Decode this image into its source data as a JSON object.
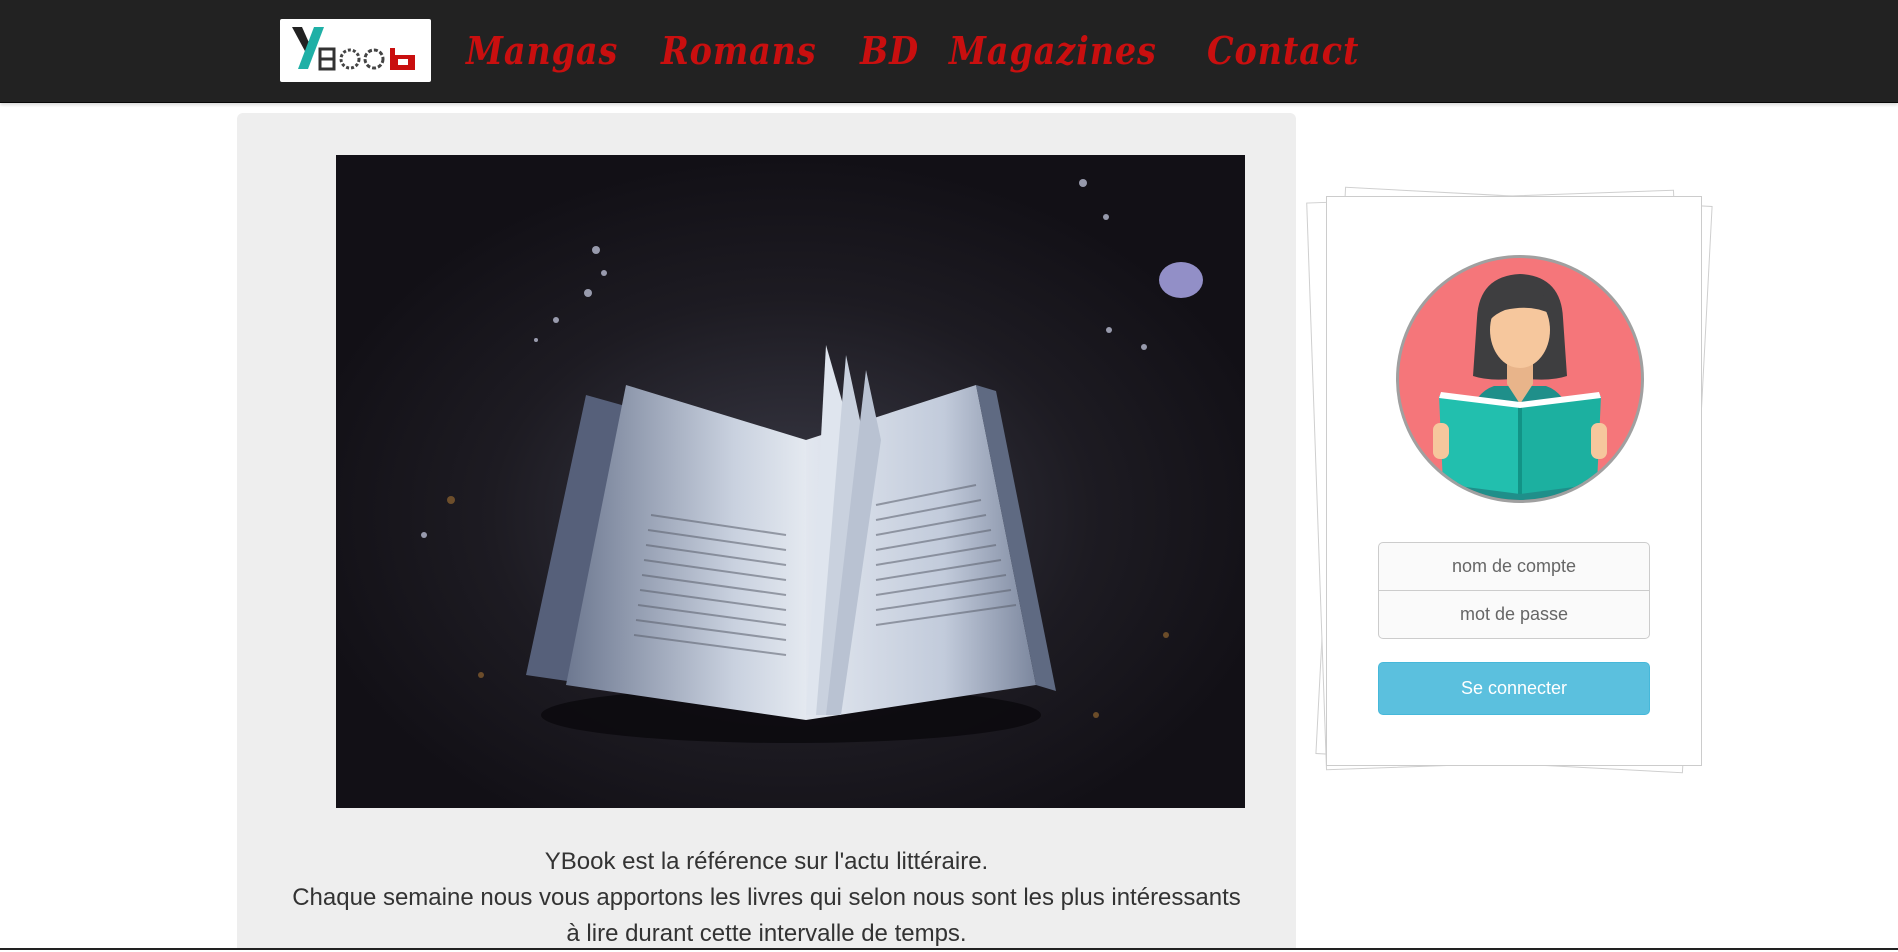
{
  "brand": {
    "logo_text": "YBOOK",
    "colors": {
      "navbar": "#222222",
      "nav_link": "#c90f0f",
      "button": "#5bc0de",
      "panel": "#eeeeee",
      "avatar_bg": "#f5767a"
    }
  },
  "nav": {
    "items": [
      {
        "label": "Mangas"
      },
      {
        "label": "Romans"
      },
      {
        "label": "BD"
      },
      {
        "label": "Magazines"
      },
      {
        "label": "Contact"
      }
    ]
  },
  "main": {
    "hero_image": "open-book-photo",
    "intro_line1": "YBook est la référence sur l'actu littéraire.",
    "intro_line2": "Chaque semaine nous vous apportons les livres qui selon nous sont les plus intéressants à lire durant cette intervalle de temps."
  },
  "login": {
    "avatar": "woman-reading-book-avatar",
    "username_placeholder": "nom de compte",
    "password_placeholder": "mot de passe",
    "submit_label": "Se connecter"
  }
}
